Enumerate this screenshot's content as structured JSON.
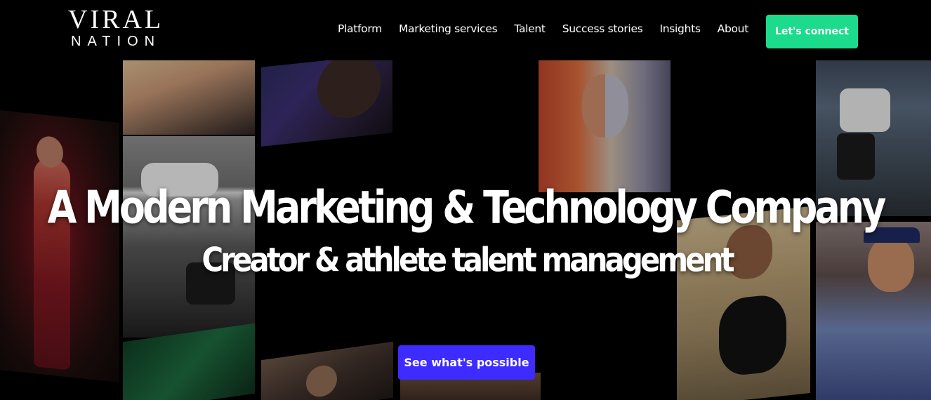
{
  "brand": {
    "name_top": "VIRAL",
    "name_bottom": "NATION"
  },
  "nav": {
    "items": [
      {
        "label": "Platform"
      },
      {
        "label": "Marketing services"
      },
      {
        "label": "Talent"
      },
      {
        "label": "Success stories"
      },
      {
        "label": "Insights"
      },
      {
        "label": "About"
      }
    ],
    "cta_label": "Let's connect"
  },
  "hero": {
    "headline": "A Modern Marketing & Technology Company",
    "subheadline": "Creator & athlete talent management",
    "cta_label": "See what's possible"
  },
  "colors": {
    "background": "#000000",
    "connect_button": "#1ddb8d",
    "possible_button": "#3e2bff",
    "text": "#ffffff"
  }
}
